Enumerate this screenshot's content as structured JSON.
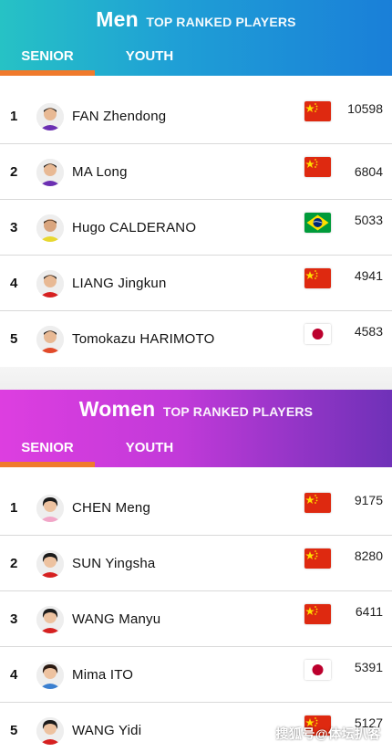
{
  "men": {
    "title": "Men",
    "subtitle": "TOP RANKED PLAYERS",
    "tabs": [
      {
        "label": "SENIOR",
        "active": true
      },
      {
        "label": "YOUTH",
        "active": false
      }
    ],
    "players": [
      {
        "rank": "1",
        "name": "FAN Zhendong",
        "country": "China",
        "flag": "cn-flag-icon",
        "points": "10598"
      },
      {
        "rank": "2",
        "name": "MA Long",
        "country": "China",
        "flag": "cn-flag-icon",
        "points": "6804"
      },
      {
        "rank": "3",
        "name": "Hugo CALDERANO",
        "country": "Brazil",
        "flag": "br-flag-icon",
        "points": "5033"
      },
      {
        "rank": "4",
        "name": "LIANG Jingkun",
        "country": "China",
        "flag": "cn-flag-icon",
        "points": "4941"
      },
      {
        "rank": "5",
        "name": "Tomokazu HARIMOTO",
        "country": "Japan",
        "flag": "jp-flag-icon",
        "points": "4583"
      }
    ]
  },
  "women": {
    "title": "Women",
    "subtitle": "TOP RANKED PLAYERS",
    "tabs": [
      {
        "label": "SENIOR",
        "active": true
      },
      {
        "label": "YOUTH",
        "active": false
      }
    ],
    "players": [
      {
        "rank": "1",
        "name": "CHEN Meng",
        "country": "China",
        "flag": "cn-flag-icon",
        "points": "9175"
      },
      {
        "rank": "2",
        "name": "SUN Yingsha",
        "country": "China",
        "flag": "cn-flag-icon",
        "points": "8280"
      },
      {
        "rank": "3",
        "name": "WANG Manyu",
        "country": "China",
        "flag": "cn-flag-icon",
        "points": "6411"
      },
      {
        "rank": "4",
        "name": "Mima ITO",
        "country": "Japan",
        "flag": "jp-flag-icon",
        "points": "5391"
      },
      {
        "rank": "5",
        "name": "WANG Yidi",
        "country": "China",
        "flag": "cn-flag-icon",
        "points": "5127"
      }
    ]
  },
  "watermark": "搜狐号@体坛扒客",
  "colors": {
    "men_gradient": [
      "#26c2c5",
      "#1a7fd8"
    ],
    "women_gradient": [
      "#dd3ee0",
      "#6f31b8"
    ],
    "tab_underline": "#f07a2c"
  }
}
